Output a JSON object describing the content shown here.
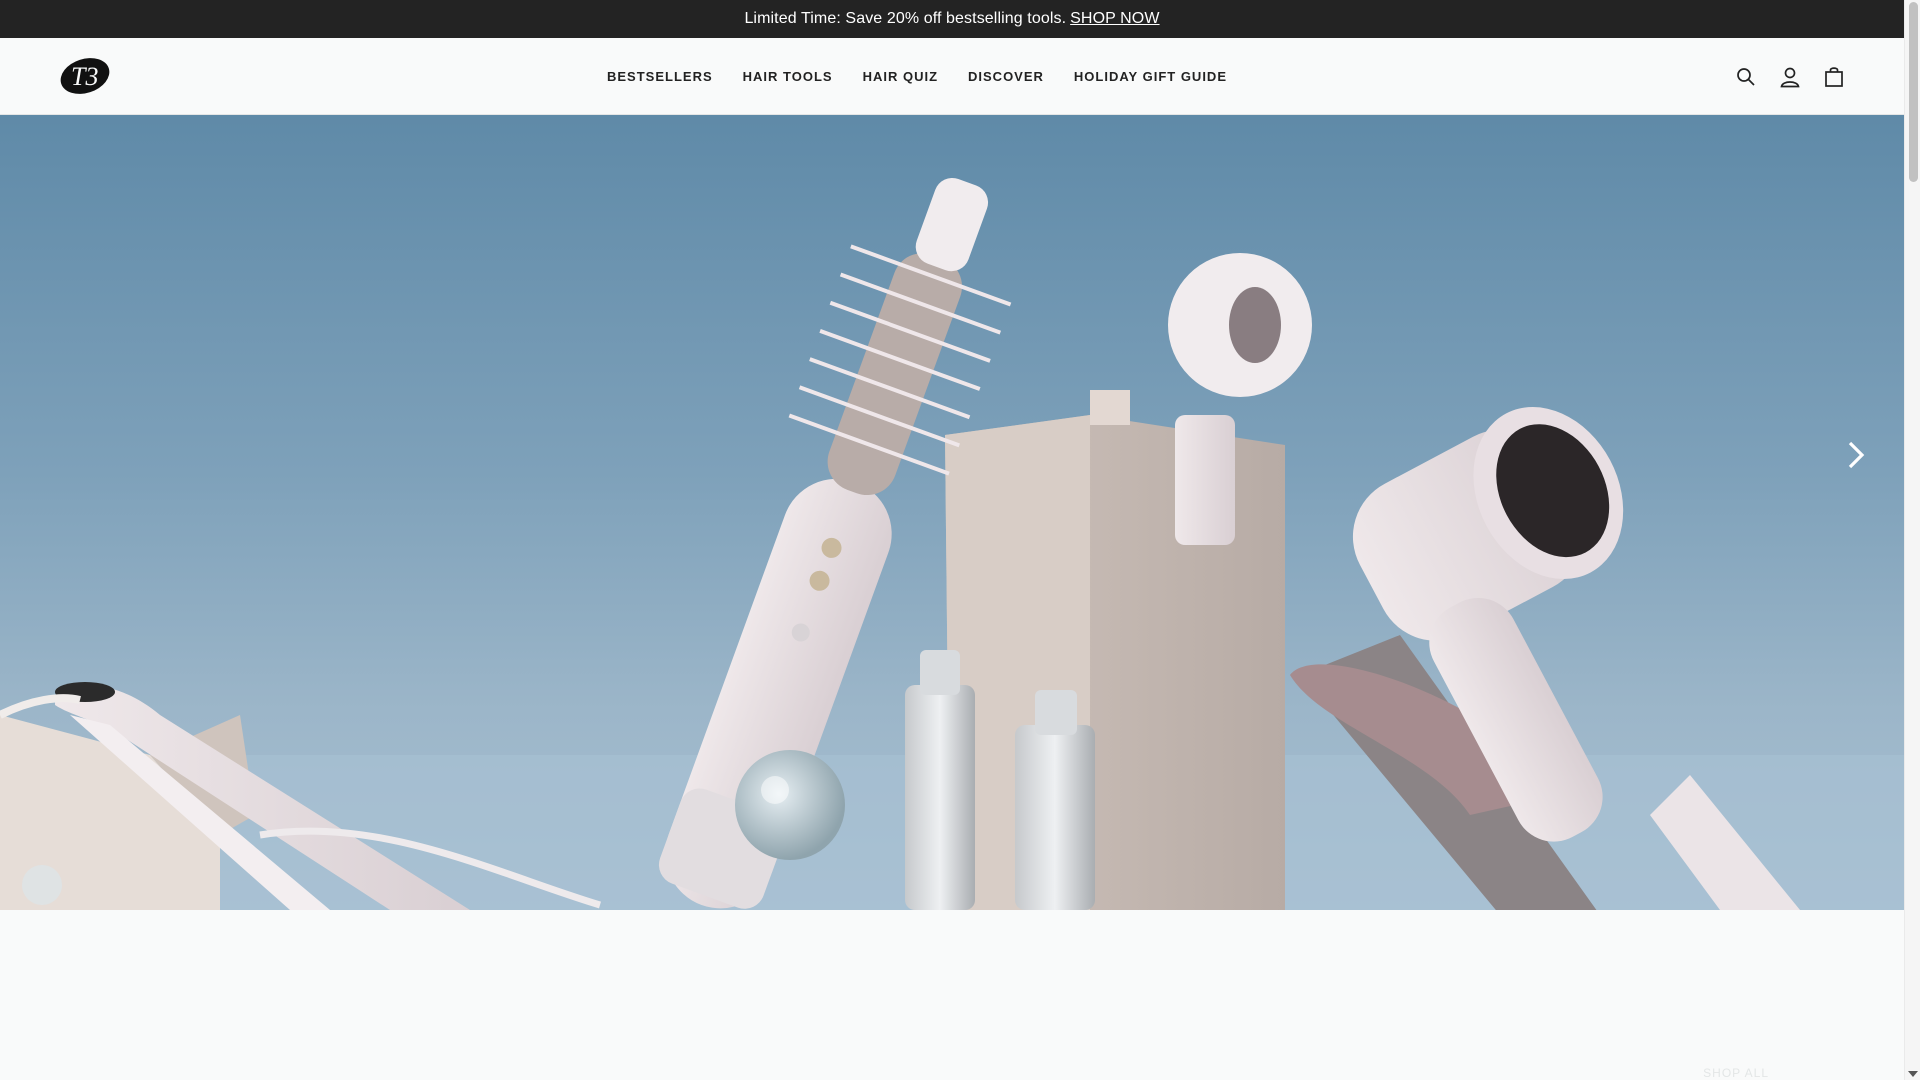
{
  "announcement": {
    "text": "Limited Time: Save 20% off bestselling tools.",
    "link_label": " SHOP NOW"
  },
  "header": {
    "logo_text": "T3",
    "nav": [
      {
        "label": "BESTSELLERS"
      },
      {
        "label": "HAIR TOOLS"
      },
      {
        "label": "HAIR QUIZ"
      },
      {
        "label": "DISCOVER"
      },
      {
        "label": "HOLIDAY GIFT GUIDE"
      }
    ],
    "icons": [
      "search-icon",
      "account-icon",
      "cart-icon"
    ]
  },
  "hero": {
    "next_icon": "chevron-right-icon"
  },
  "section": {
    "shop_all_label": "SHOP ALL"
  },
  "colors": {
    "announcement_bg": "#232323",
    "header_bg": "#f9fafa",
    "hero_sky": "#7ea1ba",
    "text": "#222222"
  }
}
